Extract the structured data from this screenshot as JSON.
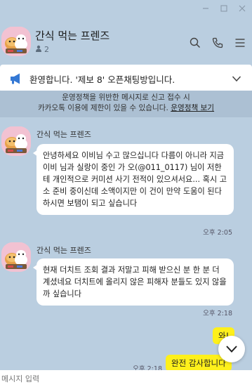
{
  "room": {
    "title": "간식 먹는 프렌즈",
    "member_count": "2"
  },
  "notice": {
    "text": "환영합니다. '제보 8' 오픈채팅방입니다."
  },
  "policy": {
    "line1": "운영정책을 위반한 메시지로 신고 접수 시",
    "line2": "카카오톡 이용에 제한이 있을 수 있습니다.",
    "link": "운영정책 보기"
  },
  "messages": [
    {
      "sender": "간식 먹는 프렌즈",
      "text": "안녕하세요 이비님 수고 많으십니다 다름이 아니라 지금 이비 님과 실랑이 중인 가 오(@011_0117) 님이 저한테 개인적으로 커미션 사기 전적이 있으셔서요... 혹시 고소 준비 중이신데 소액이지만 이 건이 만약 도움이 된다 하시면 보탬이 되고 싶습니다",
      "time": "오후 2:05"
    },
    {
      "sender": "간식 먹는 프렌즈",
      "text": "현재 더치트 조회 결과 저말고 피해 받으신 분 한 분 더 계셨네요 더치트에 올리지 않은 피해자 분들도 있지 않을까 싶습니다",
      "time": "오후 2:18"
    }
  ],
  "my_messages": [
    {
      "text": "와!"
    },
    {
      "text": "완전 감사합니다"
    }
  ],
  "my_time": "오후 2:18",
  "input": {
    "placeholder": "메시지 입력"
  },
  "colors": {
    "chat_bg": "#bacee0",
    "my_bubble": "#fef01b",
    "notice_icon": "#3478d4"
  }
}
